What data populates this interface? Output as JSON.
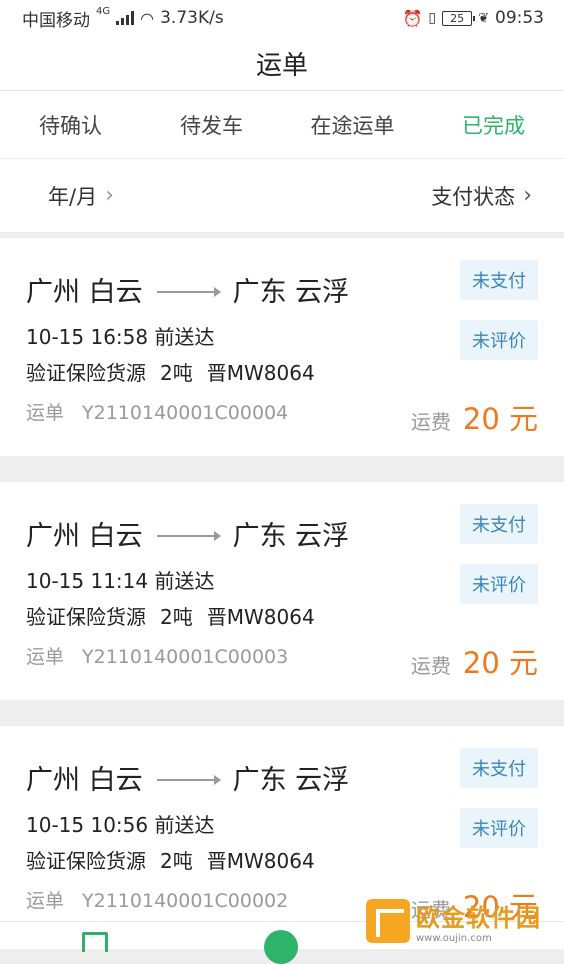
{
  "statusbar": {
    "carrier": "中国移动",
    "net": "4G",
    "speed": "3.73K/s",
    "battery": "25",
    "time": "09:53"
  },
  "header": {
    "title": "运单"
  },
  "tabs": [
    {
      "label": "待确认",
      "active": false
    },
    {
      "label": "待发车",
      "active": false
    },
    {
      "label": "在途运单",
      "active": false
    },
    {
      "label": "已完成",
      "active": true
    }
  ],
  "filters": {
    "date_label": "年/月",
    "pay_label": "支付状态"
  },
  "cards": [
    {
      "from": "广州 白云",
      "to": "广东 云浮",
      "pay_status": "未支付",
      "review_status": "未评价",
      "time": "10-15 16:58 前送达",
      "cargo": "验证保险货源",
      "weight": "2吨",
      "plate": "晋MW8064",
      "waybill_label": "运单",
      "waybill_no": "Y2110140001C00004",
      "fee_label": "运费",
      "fee": "20 元"
    },
    {
      "from": "广州 白云",
      "to": "广东 云浮",
      "pay_status": "未支付",
      "review_status": "未评价",
      "time": "10-15 11:14 前送达",
      "cargo": "验证保险货源",
      "weight": "2吨",
      "plate": "晋MW8064",
      "waybill_label": "运单",
      "waybill_no": "Y2110140001C00003",
      "fee_label": "运费",
      "fee": "20 元"
    },
    {
      "from": "广州 白云",
      "to": "广东 云浮",
      "pay_status": "未支付",
      "review_status": "未评价",
      "time": "10-15 10:56 前送达",
      "cargo": "验证保险货源",
      "weight": "2吨",
      "plate": "晋MW8064",
      "waybill_label": "运单",
      "waybill_no": "Y2110140001C00002",
      "fee_label": "运费",
      "fee": "20 元"
    }
  ],
  "watermark": {
    "text": "欧金软件园",
    "sub": "www.oujin.com"
  }
}
